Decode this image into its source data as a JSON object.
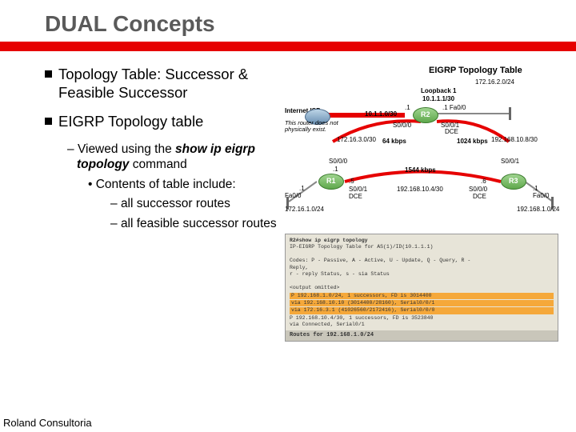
{
  "title": "DUAL Concepts",
  "bullets": {
    "b1": "Topology Table: Successor & Feasible Successor",
    "b2": "EIGRP Topology table",
    "s1_pre": "Viewed using the ",
    "s1_cmd": "show ip eigrp topology",
    "s1_post": " command",
    "s2": "Contents of table include:",
    "s3a": "all successor routes",
    "s3b": "all feasible successor routes"
  },
  "diagram": {
    "title": "EIGRP Topology Table",
    "net_top": "172.16.2.0/24",
    "loopback": "Loopback 1",
    "loopback_ip": "10.1.1.1/30",
    "isp": "Internet ISP",
    "note": "This router does not physically exist.",
    "link_br": "10.1.1.0/30",
    "r2_if_l": ".1",
    "r2_if_r": ".1  Fa0/0",
    "r2_s000": "S0/0/0",
    "r2_s001": "S0/0/1",
    "dce": "DCE",
    "kbps64": "64 kbps",
    "kbps1024": "1024 kbps",
    "net_l": "172.16.3.0/30",
    "net_r": "192.168.10.8/30",
    "r1_s000": "S0/0/0",
    "r1_if1": ".1",
    "r1_if5": ".5",
    "r1_s001": "S0/0/1",
    "r1_dce": "DCE",
    "kbps1544": "1544 kbps",
    "net_b": "192.168.10.4/30",
    "r3_if6": ".6",
    "r3_s000": "S0/0/0",
    "r3_s001": "S0/0/1",
    "r3_dce": "DCE",
    "r1_fa": "Fa0/0",
    "r1_fa1": ".1",
    "r3_fa": "Fa0/0",
    "r3_fa1": ".1",
    "lan_l": "172.16.1.0/24",
    "lan_r": "192.168.1.0/24",
    "r1": "R1",
    "r2": "R2",
    "r3": "R3"
  },
  "terminal": {
    "l1": "R2#show ip eigrp topology",
    "l2": "IP-EIGRP Topology Table for AS(1)/ID(10.1.1.1)",
    "l3": "Codes: P - Passive, A - Active, U - Update, Q - Query, R -",
    "l4": "Reply,",
    "l5": "       r - reply Status, s - sia Status",
    "l6": "<output omitted>",
    "l7": "P 192.168.1.0/24, 1 successors, FD is 3014400",
    "l8": "        via 192.168.10.10 (3014400/28160), Serial0/0/1",
    "l9": "        via 172.16.3.1 (41026560/2172416), Serial0/0/0",
    "l10": "P 192.168.10.4/30, 1 successors, FD is 3523840",
    "l11": "        via Connected, Serial0/1",
    "footer": "Routes for 192.168.1.0/24"
  },
  "footer": "Roland Consultoria"
}
